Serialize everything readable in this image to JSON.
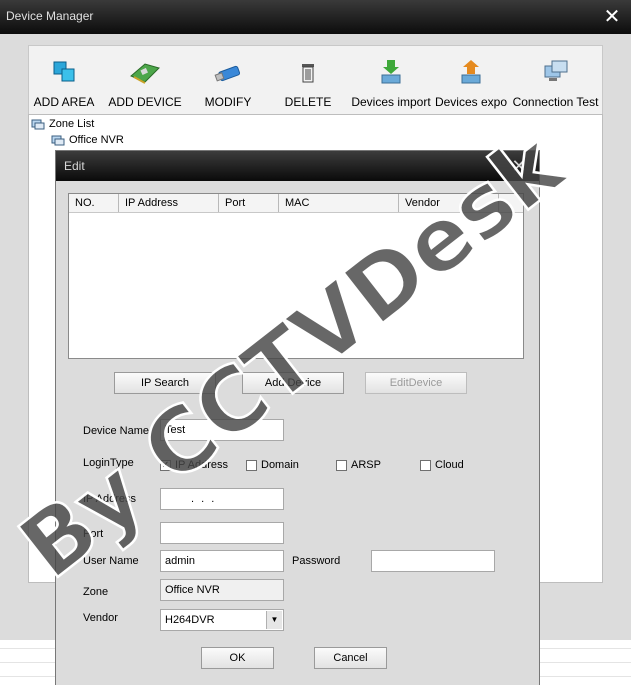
{
  "main_window": {
    "title": "Device Manager",
    "toolbar": [
      {
        "label": "ADD AREA",
        "icon": "add-area-icon"
      },
      {
        "label": "ADD DEVICE",
        "icon": "add-device-icon"
      },
      {
        "label": "MODIFY",
        "icon": "modify-icon"
      },
      {
        "label": "DELETE",
        "icon": "delete-icon"
      },
      {
        "label": "Devices import",
        "icon": "import-icon"
      },
      {
        "label": "Devices expo",
        "icon": "export-icon"
      },
      {
        "label": "Connection  Test",
        "icon": "connection-test-icon"
      }
    ],
    "tree": {
      "root": "Zone List",
      "child": "Office NVR"
    }
  },
  "edit_dialog": {
    "title": "Edit",
    "table_columns": [
      "NO.",
      "IP Address",
      "Port",
      "MAC",
      "Vendor"
    ],
    "buttons": {
      "ip_search": "IP Search",
      "add_device": "Add Device",
      "edit_device": "EditDevice",
      "ok": "OK",
      "cancel": "Cancel"
    },
    "form": {
      "device_name_label": "Device Name",
      "device_name_value": "Test",
      "login_type_label": "LoginType",
      "login_options": [
        {
          "label": "IP Address",
          "checked": true
        },
        {
          "label": "Domain",
          "checked": false
        },
        {
          "label": "ARSP",
          "checked": false
        },
        {
          "label": "Cloud",
          "checked": false
        }
      ],
      "ip_address_label": "IP Address",
      "ip_address_value": ".    .    .",
      "port_label": "Port",
      "port_value": "",
      "user_name_label": "User Name",
      "user_name_value": "admin",
      "password_label": "Password",
      "password_value": "",
      "zone_label": "Zone",
      "zone_value": "Office NVR",
      "vendor_label": "Vendor",
      "vendor_value": "H264DVR"
    }
  },
  "watermark": "By CCTVDesk"
}
